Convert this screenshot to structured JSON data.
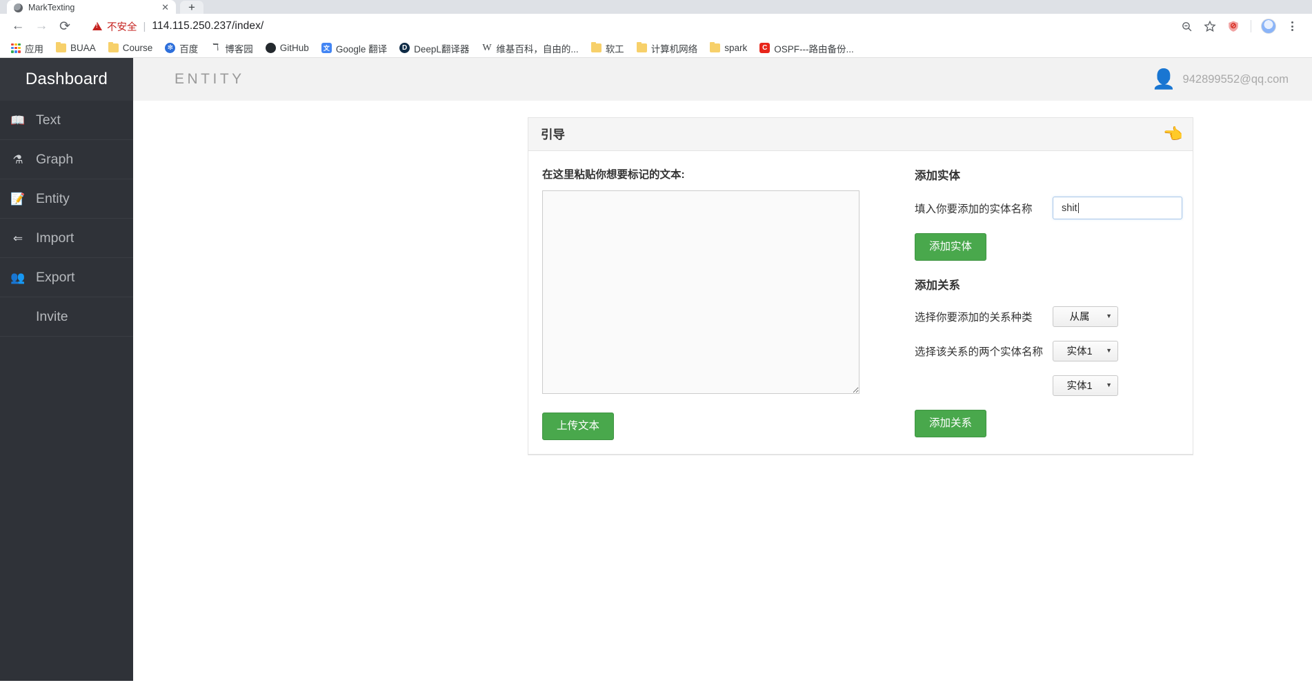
{
  "browser": {
    "tab": {
      "title": "MarkTexting",
      "close_icon": "close-icon",
      "favicon": "site-favicon"
    },
    "new_tab_label": "+",
    "nav": {
      "back": "←",
      "forward": "→",
      "reload": "⟳"
    },
    "omnibox": {
      "security_label": "不安全",
      "separator": "|",
      "url": "114.115.250.237/index/"
    },
    "toolbar_icons": {
      "zoom_out": "🔍",
      "bookmark_star": "☆",
      "shield": "◆"
    },
    "bookmarks": [
      {
        "label": "应用",
        "icon": "apps-grid-icon"
      },
      {
        "label": "BUAA",
        "icon": "folder-icon"
      },
      {
        "label": "Course",
        "icon": "folder-icon"
      },
      {
        "label": "百度",
        "icon": "baidu-icon",
        "glyph": "✻",
        "color": "#2d6fdb"
      },
      {
        "label": "博客园",
        "icon": "cnblogs-icon",
        "glyph": "ↀ",
        "color": "#3c4043"
      },
      {
        "label": "GitHub",
        "icon": "github-icon",
        "glyph": "●",
        "color": "#24292e"
      },
      {
        "label": "Google 翻译",
        "icon": "google-translate-icon",
        "glyph": "文",
        "color": "#4285f4"
      },
      {
        "label": "DeepL翻译器",
        "icon": "deepl-icon",
        "glyph": "D",
        "color": "#0f2b46"
      },
      {
        "label": "维基百科，自由的...",
        "icon": "wikipedia-icon",
        "glyph": "W"
      },
      {
        "label": "软工",
        "icon": "folder-icon"
      },
      {
        "label": "计算机网络",
        "icon": "folder-icon"
      },
      {
        "label": "spark",
        "icon": "folder-icon"
      },
      {
        "label": "OSPF---路由备份...",
        "icon": "csdn-icon",
        "glyph": "C",
        "color": "#e8261b"
      }
    ]
  },
  "sidebar": {
    "brand": "Dashboard",
    "items": [
      {
        "label": "Text",
        "icon": "book-icon",
        "glyph": "📖"
      },
      {
        "label": "Graph",
        "icon": "graph-icon",
        "glyph": "⚗"
      },
      {
        "label": "Entity",
        "icon": "memo-icon",
        "glyph": "📝"
      },
      {
        "label": "Import",
        "icon": "arrow-left-icon",
        "glyph": "⇐"
      },
      {
        "label": "Export",
        "icon": "people-icon",
        "glyph": "👥"
      },
      {
        "label": "Invite",
        "icon": "none",
        "glyph": ""
      }
    ]
  },
  "topbar": {
    "title": "ENTITY",
    "user_icon": "person-bust-icon",
    "user_glyph": "👤",
    "user_email": "942899552@qq.com"
  },
  "panel": {
    "header_title": "引导",
    "header_icon": "pointing-hand-icon",
    "header_glyph": "👈",
    "left": {
      "label": "在这里粘贴你想要标记的文本:",
      "textarea_value": "",
      "textarea_placeholder": "",
      "upload_button": "上传文本"
    },
    "entity_section": {
      "title": "添加实体",
      "input_label": "填入你要添加的实体名称",
      "input_value": "shit",
      "input_placeholder": "",
      "button": "添加实体"
    },
    "relation_section": {
      "title": "添加关系",
      "kind_label": "选择你要添加的关系种类",
      "kind_value": "从属",
      "entities_label": "选择该关系的两个实体名称",
      "entity_a_value": "实体1",
      "entity_b_value": "实体1",
      "dropdown_arrow": "▼",
      "button": "添加关系"
    }
  },
  "colors": {
    "accent_green": "#49a84c",
    "sidebar_dark": "#2f3238",
    "danger_red": "#c5221f"
  }
}
